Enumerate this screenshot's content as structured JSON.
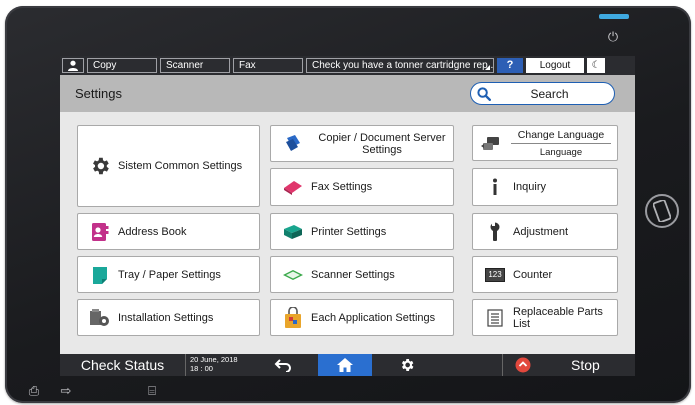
{
  "topbar": {
    "tabs": [
      "Copy",
      "Scanner",
      "Fax"
    ],
    "message": "Check you have a tonner cartridgne rep...",
    "help_label": "?",
    "logout_label": "Logout"
  },
  "header": {
    "title": "Settings",
    "search_label": "Search"
  },
  "buttons": {
    "system": "Sistem Common Settings",
    "copier": "Copier / Document Server Settings",
    "fax": "Fax Settings",
    "address": "Address Book",
    "printer": "Printer Settings",
    "tray": "Tray / Paper Settings",
    "scanner": "Scanner Settings",
    "installation": "Installation Settings",
    "each_app": "Each Application Settings",
    "change_language": "Change Language",
    "language": "Language",
    "inquiry": "Inquiry",
    "adjustment": "Adjustment",
    "counter": "Counter",
    "counter_badge": "123",
    "replaceable": "Replaceable Parts List"
  },
  "bottombar": {
    "status_label": "Check Status",
    "date": "20 June, 2018",
    "time": "18 : 00",
    "stop_label": "Stop"
  },
  "colors": {
    "accent": "#2a6fd0",
    "search_border": "#1e5fb3",
    "bar_bg": "#2b2c30",
    "header_bg": "#b8b8b8",
    "stop_red": "#e2483d"
  }
}
